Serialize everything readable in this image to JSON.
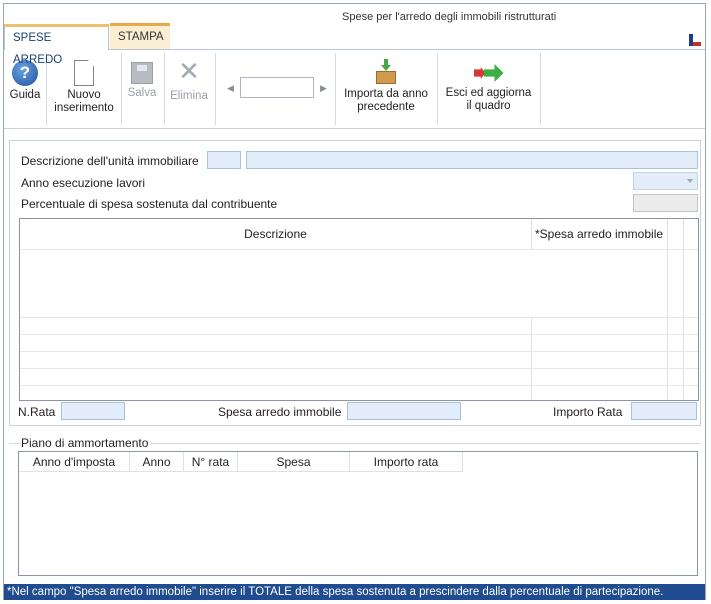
{
  "window": {
    "title": "Spese per l'arredo degli immobili ristrutturati"
  },
  "tabs": [
    {
      "label": "SPESE ARREDO",
      "active": true
    },
    {
      "label": "STAMPA",
      "active": false
    }
  ],
  "ribbon": {
    "guida": "Guida",
    "nuovo_line1": "Nuovo",
    "nuovo_line2": "inserimento",
    "salva": "Salva",
    "elimina": "Elimina",
    "nav_value": "",
    "importa_line1": "Importa da anno",
    "importa_line2": "precedente",
    "esci_line1": "Esci ed aggiorna",
    "esci_line2": "il quadro"
  },
  "form": {
    "descrizione_label": "Descrizione dell'unità immobiliare",
    "descrizione_code": "",
    "descrizione_value": "",
    "anno_label": "Anno esecuzione lavori",
    "anno_value": "",
    "percentuale_label": "Percentuale di spesa sostenuta dal contribuente",
    "percentuale_value": "",
    "grid_columns": [
      "Descrizione",
      "*Spesa arredo immobile"
    ],
    "nrata_label": "N.Rata",
    "nrata_value": "",
    "spesa_label": "Spesa arredo immobile",
    "spesa_value": "",
    "importo_label": "Importo Rata",
    "importo_value": ""
  },
  "piano": {
    "legend": "Piano di ammortamento",
    "columns": [
      "Anno d'imposta",
      "Anno",
      "N° rata",
      "Spesa",
      "Importo rata"
    ]
  },
  "footer": {
    "note": "*Nel campo \"Spesa arredo immobile\" inserire il TOTALE della spesa sostenuta a prescindere dalla percentuale di partecipazione."
  },
  "colors": {
    "accent": "#1f4c8f",
    "field": "#e3edf9",
    "tab_stampa": "#fbeed2"
  },
  "icons": [
    "help-icon",
    "new-document-icon",
    "save-icon",
    "delete-icon",
    "prev-arrow-icon",
    "next-arrow-icon",
    "import-icon",
    "exit-icon",
    "flag-icon"
  ]
}
